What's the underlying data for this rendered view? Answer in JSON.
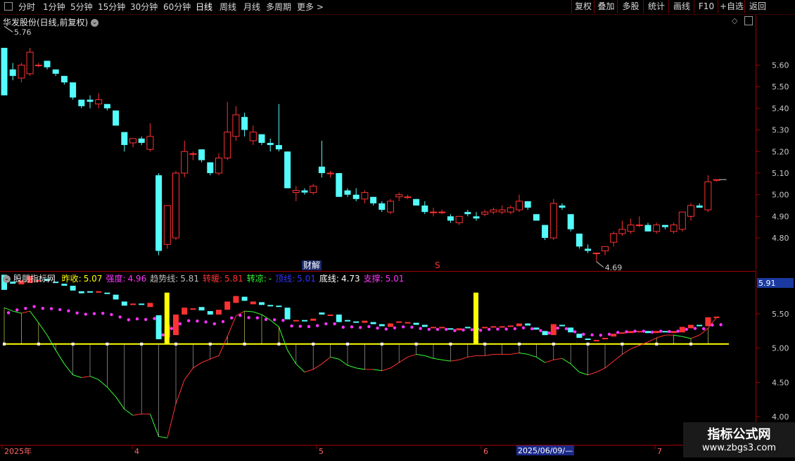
{
  "toolbar": {
    "left_items": [
      "分时",
      "1分钟",
      "5分钟",
      "15分钟",
      "30分钟",
      "60分钟",
      "日线",
      "周线",
      "月线",
      "多周期",
      "更多 >"
    ],
    "active": "日线",
    "right_items": [
      "复权",
      "叠加",
      "多股",
      "统计",
      "画线",
      "F10",
      "+自选",
      "返回"
    ]
  },
  "main_title": "华发股份(日线,前复权)",
  "price_axis": {
    "ticks": [
      "5.60",
      "5.50",
      "5.40",
      "5.30",
      "5.20",
      "5.10",
      "5.00",
      "4.90",
      "4.80"
    ]
  },
  "high_label": "5.76",
  "low_label": "4.69",
  "markers": {
    "caijie": "财解",
    "s": "S"
  },
  "indicator": {
    "name": "股朋指标网",
    "items": [
      {
        "label": "昨收:",
        "value": "5.07",
        "color": "#ffff00"
      },
      {
        "label": "强度:",
        "value": "4.96",
        "color": "#ff33ff"
      },
      {
        "label": "趋势线:",
        "value": "5.81",
        "color": "#bbbbbb"
      },
      {
        "label": "转暖:",
        "value": "5.81",
        "color": "#ff3333"
      },
      {
        "label": "转凉:",
        "value": "-",
        "color": "#33ff33"
      },
      {
        "label": "顶线:",
        "value": "5.01",
        "color": "#3333ff"
      },
      {
        "label": "底线:",
        "value": "4.73",
        "color": "#ffffff"
      },
      {
        "label": "支撑:",
        "value": "5.01",
        "color": "#ff33ff"
      }
    ]
  },
  "ind_axis": {
    "current": "5.91",
    "ticks": [
      "5.50",
      "5.00",
      "4.50",
      "4.00"
    ]
  },
  "date_axis": {
    "labels": [
      "2025年",
      "4",
      "5",
      "6",
      "7"
    ],
    "current_date": "2025/06/09/—"
  },
  "watermark": {
    "line1": "指标公式网",
    "line2": "www.zbgs3.com"
  },
  "colors": {
    "up": "#ff3232",
    "down": "#54fcfc",
    "grid": "#a00000",
    "yellow": "#ffff00"
  },
  "chart_data": {
    "type": "candlestick",
    "ylim": [
      4.66,
      5.82
    ],
    "ohlc": [
      [
        5.68,
        5.68,
        5.46,
        5.46
      ],
      [
        5.58,
        5.61,
        5.53,
        5.55
      ],
      [
        5.54,
        5.61,
        5.52,
        5.6
      ],
      [
        5.56,
        5.68,
        5.55,
        5.66
      ],
      [
        5.6,
        5.61,
        5.59,
        5.6
      ],
      [
        5.62,
        5.62,
        5.58,
        5.59
      ],
      [
        5.58,
        5.58,
        5.55,
        5.56
      ],
      [
        5.55,
        5.55,
        5.51,
        5.52
      ],
      [
        5.52,
        5.52,
        5.44,
        5.45
      ],
      [
        5.44,
        5.44,
        5.4,
        5.41
      ],
      [
        5.44,
        5.46,
        5.4,
        5.43
      ],
      [
        5.42,
        5.47,
        5.4,
        5.44
      ],
      [
        5.42,
        5.42,
        5.39,
        5.4
      ],
      [
        5.39,
        5.39,
        5.32,
        5.32
      ],
      [
        5.29,
        5.29,
        5.2,
        5.23
      ],
      [
        5.24,
        5.26,
        5.22,
        5.26
      ],
      [
        5.26,
        5.27,
        5.23,
        5.24
      ],
      [
        5.21,
        5.33,
        5.2,
        5.27
      ],
      [
        5.09,
        5.1,
        4.72,
        4.74
      ],
      [
        4.77,
        4.95,
        4.75,
        4.95
      ],
      [
        4.8,
        5.11,
        4.79,
        5.1
      ],
      [
        5.1,
        5.25,
        5.08,
        5.2
      ],
      [
        5.19,
        5.2,
        5.16,
        5.19
      ],
      [
        5.21,
        5.21,
        5.15,
        5.16
      ],
      [
        5.15,
        5.15,
        5.09,
        5.1
      ],
      [
        5.1,
        5.19,
        5.09,
        5.17
      ],
      [
        5.17,
        5.43,
        5.16,
        5.29
      ],
      [
        5.27,
        5.41,
        5.25,
        5.37
      ],
      [
        5.36,
        5.38,
        5.27,
        5.3
      ],
      [
        5.25,
        5.32,
        5.23,
        5.29
      ],
      [
        5.28,
        5.28,
        5.23,
        5.24
      ],
      [
        5.24,
        5.26,
        5.2,
        5.23
      ],
      [
        5.23,
        5.42,
        5.2,
        5.21
      ],
      [
        5.2,
        5.2,
        5.03,
        5.03
      ],
      [
        5.01,
        5.04,
        4.97,
        5.02
      ],
      [
        5.02,
        5.03,
        5.0,
        5.01
      ],
      [
        5.01,
        5.05,
        5.0,
        5.04
      ],
      [
        5.13,
        5.25,
        5.08,
        5.1
      ],
      [
        5.1,
        5.11,
        5.08,
        5.1
      ],
      [
        5.1,
        5.1,
        4.99,
        4.99
      ],
      [
        5.02,
        5.03,
        4.99,
        5.0
      ],
      [
        5.0,
        5.03,
        4.97,
        4.98
      ],
      [
        4.98,
        5.02,
        4.96,
        5.01
      ],
      [
        4.99,
        4.99,
        4.95,
        4.96
      ],
      [
        4.96,
        4.97,
        4.92,
        4.93
      ],
      [
        4.92,
        4.98,
        4.91,
        4.97
      ],
      [
        4.99,
        5.01,
        4.97,
        5.0
      ],
      [
        4.99,
        5.0,
        4.98,
        4.99
      ],
      [
        4.98,
        4.98,
        4.95,
        4.95
      ],
      [
        4.95,
        4.97,
        4.91,
        4.92
      ],
      [
        4.92,
        4.94,
        4.9,
        4.92
      ],
      [
        4.92,
        4.93,
        4.91,
        4.92
      ],
      [
        4.9,
        4.91,
        4.87,
        4.88
      ],
      [
        4.87,
        4.9,
        4.86,
        4.9
      ],
      [
        4.92,
        4.93,
        4.9,
        4.91
      ],
      [
        4.9,
        4.92,
        4.88,
        4.89
      ],
      [
        4.91,
        4.93,
        4.9,
        4.92
      ],
      [
        4.92,
        4.94,
        4.91,
        4.93
      ],
      [
        4.92,
        4.95,
        4.91,
        4.93
      ],
      [
        4.92,
        4.95,
        4.91,
        4.94
      ],
      [
        4.93,
        5.0,
        4.92,
        4.97
      ],
      [
        4.97,
        4.97,
        4.93,
        4.94
      ],
      [
        4.91,
        4.91,
        4.88,
        4.88
      ],
      [
        4.86,
        4.86,
        4.79,
        4.8
      ],
      [
        4.8,
        4.98,
        4.79,
        4.96
      ],
      [
        4.95,
        4.96,
        4.93,
        4.94
      ],
      [
        4.91,
        4.91,
        4.83,
        4.84
      ],
      [
        4.82,
        4.82,
        4.75,
        4.76
      ],
      [
        4.75,
        4.77,
        4.73,
        4.74
      ],
      [
        4.73,
        4.73,
        4.69,
        4.73
      ],
      [
        4.74,
        4.76,
        4.72,
        4.76
      ],
      [
        4.78,
        4.83,
        4.76,
        4.82
      ],
      [
        4.82,
        4.88,
        4.81,
        4.84
      ],
      [
        4.83,
        4.89,
        4.82,
        4.86
      ],
      [
        4.86,
        4.9,
        4.85,
        4.86
      ],
      [
        4.86,
        4.87,
        4.83,
        4.83
      ],
      [
        4.83,
        4.87,
        4.82,
        4.86
      ],
      [
        4.86,
        4.86,
        4.84,
        4.85
      ],
      [
        4.83,
        4.87,
        4.82,
        4.86
      ],
      [
        4.84,
        4.92,
        4.83,
        4.92
      ],
      [
        4.9,
        4.96,
        4.88,
        4.95
      ],
      [
        4.95,
        4.96,
        4.94,
        4.94
      ],
      [
        4.93,
        5.09,
        4.92,
        5.06
      ],
      [
        5.07,
        5.07,
        5.06,
        5.07
      ]
    ]
  }
}
